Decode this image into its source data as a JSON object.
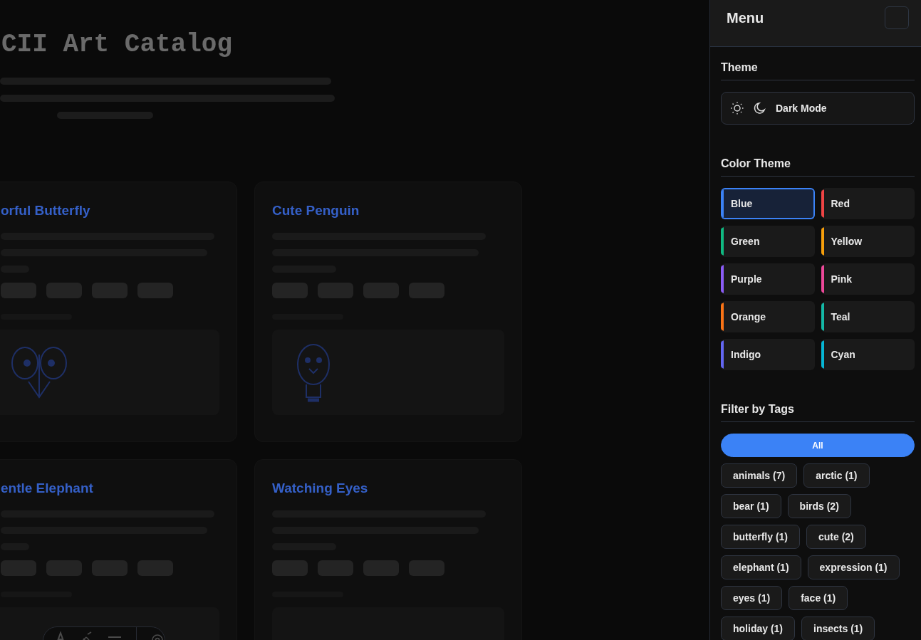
{
  "catalog": {
    "title": "CII Art Catalog"
  },
  "cards": [
    {
      "title": "orful Butterfly",
      "kind": "butterfly"
    },
    {
      "title": "Cute Penguin",
      "kind": "penguin"
    },
    {
      "title": "entle Elephant",
      "kind": "none"
    },
    {
      "title": "Watching Eyes",
      "kind": "none"
    }
  ],
  "menu": {
    "title": "Menu"
  },
  "theme": {
    "heading": "Theme",
    "mode": "Dark Mode"
  },
  "color_theme": {
    "heading": "Color Theme",
    "options": [
      {
        "label": "Blue",
        "color": "#3b82f6",
        "selected": true
      },
      {
        "label": "Red",
        "color": "#ef4444",
        "selected": false
      },
      {
        "label": "Green",
        "color": "#10b981",
        "selected": false
      },
      {
        "label": "Yellow",
        "color": "#f59e0b",
        "selected": false
      },
      {
        "label": "Purple",
        "color": "#8b5cf6",
        "selected": false
      },
      {
        "label": "Pink",
        "color": "#ec4899",
        "selected": false
      },
      {
        "label": "Orange",
        "color": "#f97316",
        "selected": false
      },
      {
        "label": "Teal",
        "color": "#14b8a6",
        "selected": false
      },
      {
        "label": "Indigo",
        "color": "#6366f1",
        "selected": false
      },
      {
        "label": "Cyan",
        "color": "#06b6d4",
        "selected": false
      }
    ]
  },
  "tag_filter": {
    "heading": "Filter by Tags",
    "items": [
      {
        "label": "All",
        "selected": true
      },
      {
        "label": "animals (7)",
        "selected": false
      },
      {
        "label": "arctic (1)",
        "selected": false
      },
      {
        "label": "bear (1)",
        "selected": false
      },
      {
        "label": "birds (2)",
        "selected": false
      },
      {
        "label": "butterfly (1)",
        "selected": false
      },
      {
        "label": "cute (2)",
        "selected": false
      },
      {
        "label": "elephant (1)",
        "selected": false
      },
      {
        "label": "expression (1)",
        "selected": false
      },
      {
        "label": "eyes (1)",
        "selected": false
      },
      {
        "label": "face (1)",
        "selected": false
      },
      {
        "label": "holiday (1)",
        "selected": false
      },
      {
        "label": "insects (1)",
        "selected": false
      }
    ]
  }
}
